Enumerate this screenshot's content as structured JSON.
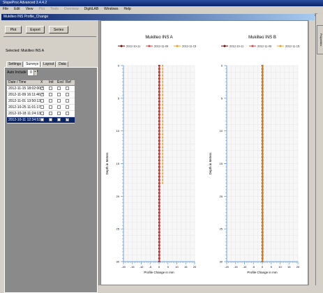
{
  "app": {
    "title": "SlopeProc Advanced 3.4.4.2",
    "menu": [
      "File",
      "Edit",
      "View",
      "Plot",
      "Tools",
      "Overview",
      "DigitiLAB",
      "Windows",
      "Help"
    ],
    "menu_dim": [
      false,
      false,
      false,
      true,
      true,
      true,
      false,
      false,
      false
    ]
  },
  "child": {
    "title": "Mukilteo INS Profile_Change"
  },
  "controls": {
    "plot_label": "Plot",
    "export_label": "Export",
    "series_label": "Series",
    "selected_label": "Selected: Mukilteo INS A",
    "tabs": [
      "Settings",
      "Surveys",
      "Layout",
      "Data"
    ],
    "active_tab": 1,
    "auto_include_label": "Auto Include",
    "auto_include_value": "0"
  },
  "survey_table": {
    "headers": [
      "Date / Time",
      "X",
      "Init",
      "Excl",
      "Ref"
    ],
    "rows": [
      {
        "date": "2012-11-15 18:02:00",
        "checks": [
          true,
          false,
          false,
          false
        ],
        "selected": false
      },
      {
        "date": "2012-11-09 16:11:46",
        "checks": [
          true,
          false,
          false,
          false
        ],
        "selected": false
      },
      {
        "date": "2012-11-01 13:50:13",
        "checks": [
          false,
          false,
          false,
          false
        ],
        "selected": false
      },
      {
        "date": "2012-10-25 11:01:17",
        "checks": [
          false,
          false,
          false,
          false
        ],
        "selected": false
      },
      {
        "date": "2012-10-18 11:24:13",
        "checks": [
          false,
          false,
          false,
          false
        ],
        "selected": false
      },
      {
        "date": "2012-10-11 12:34:53",
        "checks": [
          false,
          false,
          false,
          true
        ],
        "selected": true
      }
    ]
  },
  "side_tab": "Properties",
  "colors": {
    "series1": "#7a0000",
    "series2": "#e04040",
    "series3": "#f0a020",
    "axis": "#6fa0d8",
    "grid": "#e6e6e6"
  },
  "chart_data": [
    {
      "type": "line",
      "title": "Mukilteo INS A",
      "xlabel": "Profile Change in mm",
      "ylabel": "Depth in Meters",
      "xlim": [
        -20,
        20
      ],
      "ylim": [
        0,
        30
      ],
      "x_ticks": [
        -20,
        -15,
        -10,
        -5,
        0,
        5,
        10,
        15,
        20
      ],
      "y_ticks": [
        0,
        5,
        10,
        15,
        20,
        25,
        30
      ],
      "legend": [
        "2012-10-11",
        "2012-11-09",
        "2012-11-15"
      ],
      "legend_position": "top",
      "grid": true,
      "series": [
        {
          "name": "2012-10-11",
          "values": [
            [
              0,
              0
            ],
            [
              0,
              30
            ]
          ]
        },
        {
          "name": "2012-11-09",
          "values": [
            [
              0,
              0
            ],
            [
              0,
              30
            ]
          ]
        },
        {
          "name": "2012-11-15",
          "values": [
            [
              2,
              0
            ],
            [
              2,
              18
            ]
          ]
        }
      ]
    },
    {
      "type": "line",
      "title": "Mukilteo INS B",
      "xlabel": "Profile Change in mm",
      "ylabel": "Depth in Meters",
      "xlim": [
        -20,
        20
      ],
      "ylim": [
        0,
        30
      ],
      "x_ticks": [
        -20,
        -15,
        -10,
        -5,
        0,
        5,
        10,
        15,
        20
      ],
      "y_ticks": [
        0,
        5,
        10,
        15,
        20,
        25,
        30
      ],
      "legend": [
        "2012-10-11",
        "2012-11-09",
        "2012-11-15"
      ],
      "legend_position": "top",
      "grid": true,
      "series": [
        {
          "name": "2012-10-11",
          "values": [
            [
              0,
              0
            ],
            [
              0,
              30
            ]
          ]
        },
        {
          "name": "2012-11-09",
          "values": [
            [
              0,
              0
            ],
            [
              0,
              30
            ]
          ]
        },
        {
          "name": "2012-11-15",
          "values": [
            [
              0.3,
              0
            ],
            [
              0.3,
              30
            ]
          ]
        }
      ]
    }
  ]
}
